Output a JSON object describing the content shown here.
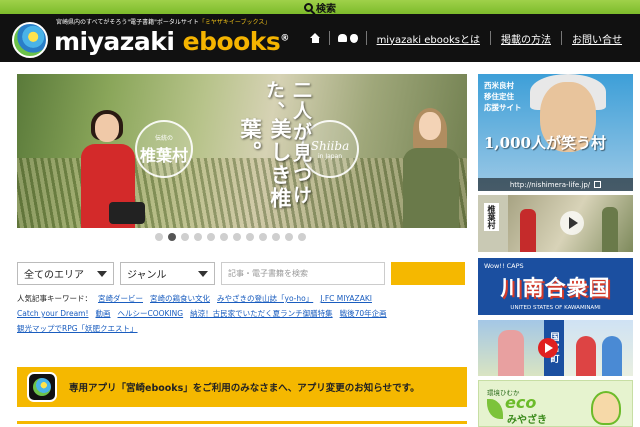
{
  "topbar": {
    "search_label": "検索"
  },
  "header": {
    "tagline_prefix": "宮崎県内のすべてがそろう\"電子書籍\"ポータルサイト",
    "tagline_accent": "「ミヤザキイーブックス」",
    "logo_part1": "miyazaki ",
    "logo_part2": "ebooks",
    "logo_mark": "®",
    "nav": [
      {
        "label": "miyazaki ebooksとは"
      },
      {
        "label": "掲載の方法"
      },
      {
        "label": "お問い合せ"
      }
    ]
  },
  "hero": {
    "stamp1_small": "伝統の",
    "stamp1_big": "椎葉村",
    "stamp2_big": "Shiiba",
    "stamp2_small": "in Japan",
    "vtext1": "二人が見つけた、",
    "vtext2": "美しき椎葉。",
    "slide_count": 12,
    "active_slide": 2
  },
  "search": {
    "area_label": "全てのエリア",
    "genre_label": "ジャンル",
    "placeholder": "記事・電子書籍を検索"
  },
  "keywords": {
    "label": "人気記事キーワード：",
    "items": [
      "宮崎ダービー",
      "宮崎の鶏食い文化",
      "みやざきの登山誌「yo-ho」",
      "J.FC MIYAZAKI",
      "Catch your Dream!",
      "動画",
      "ヘルシーCOOKING",
      "納涼！古民家でいただく夏ランチ御膳特集",
      "戦後70年企画",
      "観光マップでRPG「妖肥クエスト」"
    ]
  },
  "notice": {
    "text": "専用アプリ「宮崎ebooks」をご利用のみなさまへ、アプリ変更のお知らせです。"
  },
  "sidebar": {
    "ad1": {
      "label_line1": "西米良村",
      "label_line2": "移住定住",
      "label_line3": "応援サイト",
      "headline": "1,000人が笑う村",
      "url": "http://nishimera-life.jp/"
    },
    "ad2": {
      "label": "椎葉村"
    },
    "ad3": {
      "sub": "Wow!! CAPS",
      "title": "川南合衆国",
      "strip": "UNITED STATES OF KAWAMINAMI"
    },
    "ad4": {
      "label": "国富町"
    },
    "ad5": {
      "small": "環境ひむか",
      "eco": "eco",
      "miya": "みやざき"
    }
  }
}
